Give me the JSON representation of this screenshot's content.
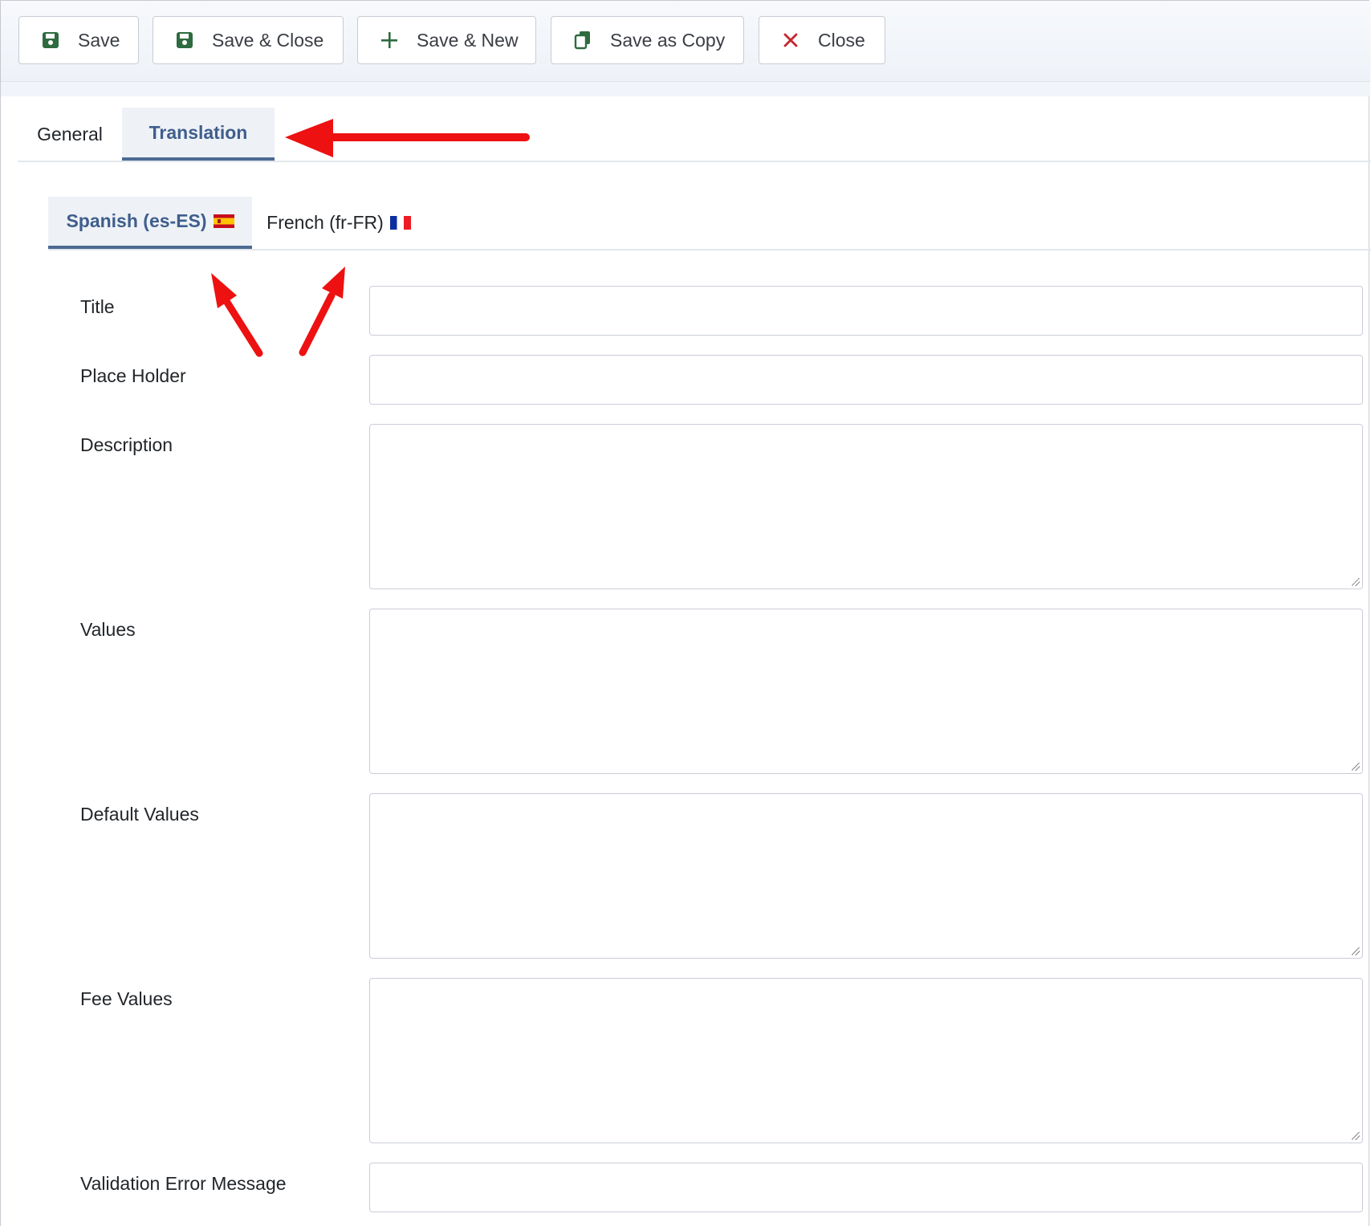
{
  "toolbar": {
    "buttons": [
      {
        "label": "Save",
        "icon": "save-icon"
      },
      {
        "label": "Save & Close",
        "icon": "save-icon"
      },
      {
        "label": "Save & New",
        "icon": "plus-icon"
      },
      {
        "label": "Save as Copy",
        "icon": "copy-icon"
      },
      {
        "label": "Close",
        "icon": "close-icon"
      }
    ]
  },
  "tabs": [
    {
      "label": "General",
      "active": false
    },
    {
      "label": "Translation",
      "active": true
    }
  ],
  "language_tabs": [
    {
      "label": "Spanish (es-ES)",
      "flag": "flag-es-icon",
      "active": true
    },
    {
      "label": "French (fr-FR)",
      "flag": "flag-fr-icon",
      "active": false
    }
  ],
  "form": {
    "title_label": "Title",
    "title_value": "",
    "placeholder_label": "Place Holder",
    "placeholder_value": "",
    "description_label": "Description",
    "description_value": "",
    "values_label": "Values",
    "values_value": "",
    "default_values_label": "Default Values",
    "default_values_value": "",
    "fee_values_label": "Fee Values",
    "fee_values_value": "",
    "validation_error_label": "Validation Error Message",
    "validation_error_value": ""
  },
  "colors": {
    "accent": "#4d6a94",
    "active_tab_text": "#3f5e8c",
    "save_icon": "#2e6b3f",
    "close_icon": "#c8252c",
    "annotation_arrow": "#ee1111"
  }
}
